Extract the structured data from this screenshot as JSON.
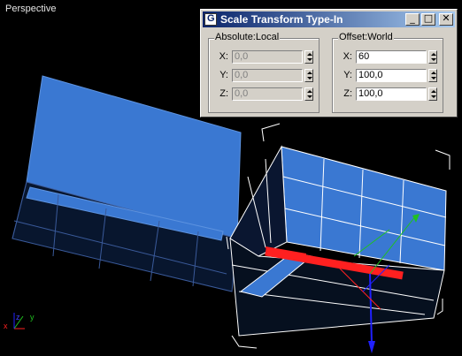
{
  "viewport": {
    "label": "Perspective"
  },
  "dialog": {
    "title": "Scale Transform Type-In",
    "title_icon": "3ds-max-icon",
    "absolute": {
      "legend": "Absolute:Local",
      "x_label": "X:",
      "x_value": "0,0",
      "y_label": "Y:",
      "y_value": "0,0",
      "z_label": "Z:",
      "z_value": "0,0"
    },
    "offset": {
      "legend": "Offset:World",
      "x_label": "X:",
      "x_value": "60",
      "y_label": "Y:",
      "y_value": "100,0",
      "z_label": "Z:",
      "z_value": "100,0"
    },
    "buttons": {
      "minimize": "_",
      "maximize": "□",
      "close": "✕"
    }
  },
  "axis_labels": {
    "x": "x",
    "y": "y",
    "z": "z"
  },
  "colors": {
    "object_fill": "#3a78d2",
    "object_dark": "#0a1a3a",
    "selection": "#ffffff",
    "gizmo_x": "#ff2020",
    "gizmo_y": "#20c020",
    "gizmo_z": "#2020ff"
  }
}
